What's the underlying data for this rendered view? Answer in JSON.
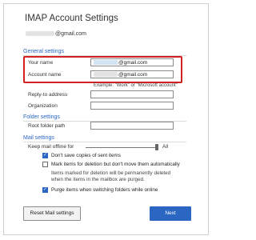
{
  "dialog": {
    "title": "IMAP Account Settings",
    "email_suffix": "@gmail.com"
  },
  "general": {
    "header": "General settings",
    "your_name_label": "Your name",
    "your_name_value_suffix": "@gmail.com",
    "account_name_label": "Account name",
    "account_name_value_suffix": "@gmail.com",
    "example_hint": "Example: \"Work\" or \"Microsoft account\"",
    "reply_to_label": "Reply-to address",
    "organization_label": "Organization"
  },
  "folder": {
    "header": "Folder settings",
    "root_label": "Root folder path"
  },
  "mail": {
    "header": "Mail settings",
    "keep_offline_label": "Keep mail offline for",
    "keep_offline_value": "All",
    "keep_offline_level": 1.0,
    "dont_save_sent_label": "Don't save copies of sent items",
    "dont_save_sent_checked": true,
    "mark_deletion_label": "Mark items for deletion but don't move them automatically",
    "mark_deletion_checked": false,
    "mark_deletion_note": "Items marked for deletion will be permanently deleted when the items in the mailbox are purged.",
    "purge_label": "Purge items when switching folders while online",
    "purge_checked": true
  },
  "buttons": {
    "reset": "Reset Mail settings",
    "next": "Next"
  },
  "colors": {
    "accent": "#2b66c2",
    "highlight": "#d32020"
  }
}
